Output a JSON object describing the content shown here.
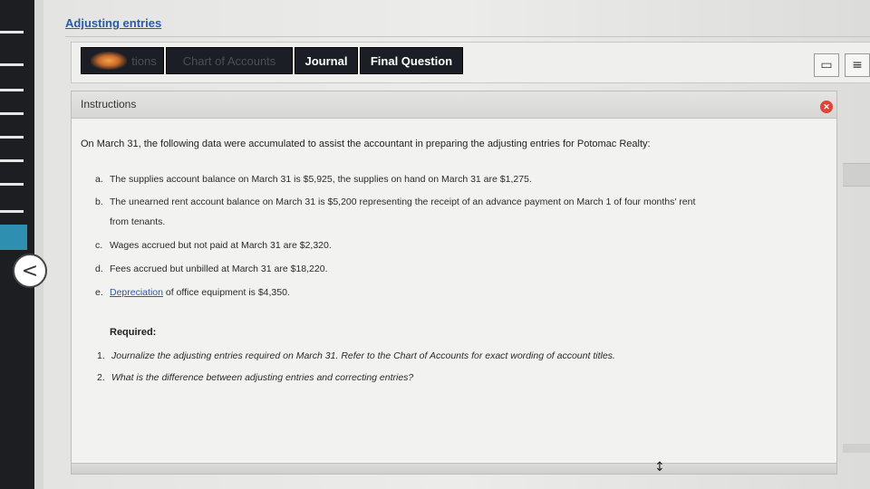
{
  "header": {
    "title": "Adjusting entries"
  },
  "tabs": [
    {
      "label": "tions",
      "state": "faded"
    },
    {
      "label": "Chart of Accounts",
      "state": "faded"
    },
    {
      "label": "Journal",
      "state": "normal"
    },
    {
      "label": "Final Question",
      "state": "normal"
    }
  ],
  "toolbar_icons": [
    "window-icon",
    "list-icon"
  ],
  "panel": {
    "title": "Instructions",
    "intro": "On March 31, the following data were accumulated to assist the accountant in preparing the adjusting entries for Potomac Realty:",
    "items": [
      {
        "label": "a.",
        "text": "The supplies account balance on March 31 is $5,925, the supplies on hand on March 31 are $1,275."
      },
      {
        "label": "b.",
        "text": "The unearned rent account balance on March 31 is $5,200 representing the receipt of an advance payment on March 1 of four months' rent",
        "cont": "from tenants."
      },
      {
        "label": "c.",
        "text": "Wages accrued but not paid at March 31 are $2,320."
      },
      {
        "label": "d.",
        "text": "Fees accrued but unbilled at March 31 are $18,220."
      },
      {
        "label": "e.",
        "link": "Depreciation",
        "text": " of office equipment is $4,350."
      }
    ],
    "required_label": "Required:",
    "questions": [
      {
        "num": "1.",
        "text": "Journalize the adjusting entries required on March 31. Refer to the Chart of Accounts for exact wording of account titles."
      },
      {
        "num": "2.",
        "text": "What is the difference between adjusting entries and correcting entries?"
      }
    ]
  },
  "colors": {
    "link": "#2a5aa8",
    "tab_bg": "#1b1e24",
    "close": "#e0433a"
  }
}
